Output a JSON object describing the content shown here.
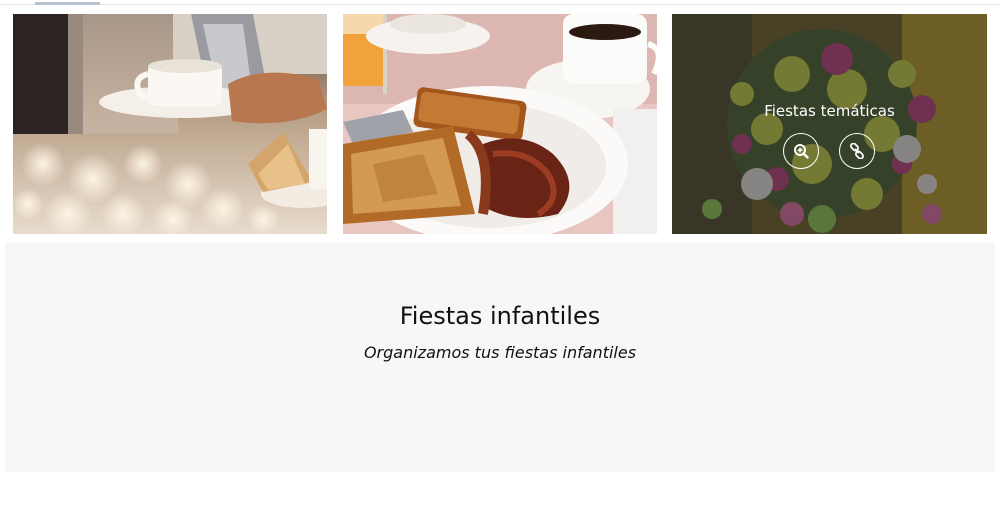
{
  "gallery": {
    "tiles": [
      {
        "image": "coffee-service-photo"
      },
      {
        "image": "french-toast-breakfast-photo"
      },
      {
        "image": "flower-bouquet-photo",
        "caption": "Fiestas temáticas",
        "zoom_icon": "zoom-in-icon",
        "link_icon": "link-icon"
      }
    ]
  },
  "feature": {
    "title": "Fiestas infantiles",
    "subtitle": "Organizamos tus fiestas infantiles"
  },
  "colors": {
    "panel_bg": "#f7f7f7",
    "overlay": "rgba(45,45,45,0.55)",
    "text": "#111111"
  }
}
